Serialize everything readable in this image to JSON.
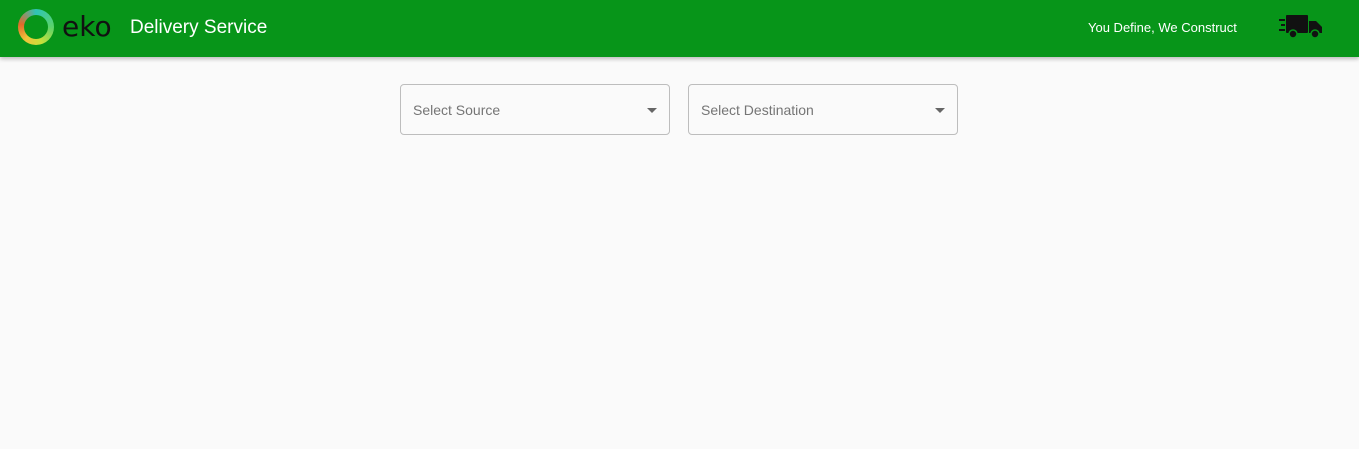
{
  "header": {
    "logo_text": "eko",
    "title": "Delivery Service",
    "tagline": "You Define, We Construct",
    "truck_icon": "delivery-truck-icon",
    "background_color": "#079519"
  },
  "main": {
    "source_select": {
      "placeholder": "Select Source"
    },
    "destination_select": {
      "placeholder": "Select Destination"
    }
  }
}
